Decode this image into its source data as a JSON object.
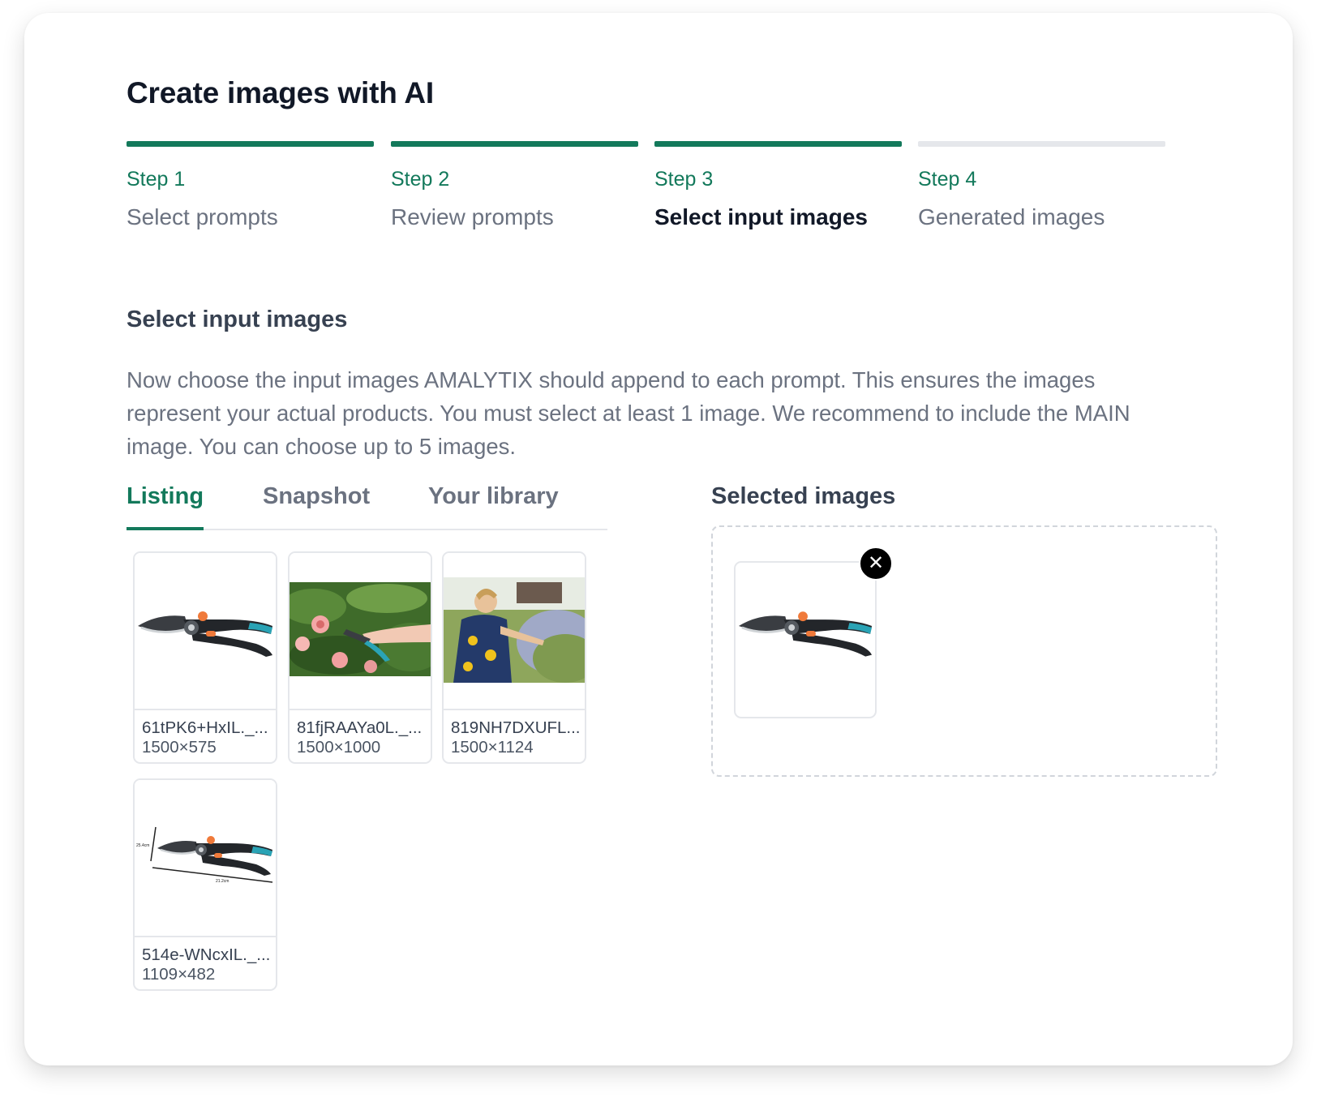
{
  "page": {
    "title": "Create images with AI"
  },
  "steps": [
    {
      "num": "Step 1",
      "label": "Select prompts"
    },
    {
      "num": "Step 2",
      "label": "Review prompts"
    },
    {
      "num": "Step 3",
      "label": "Select input images"
    },
    {
      "num": "Step 4",
      "label": "Generated images"
    }
  ],
  "section": {
    "title": "Select input images",
    "description": "Now choose the input images AMALYTIX should append to each prompt. This ensures the images represent your actual products. You must select at least 1 image. We recommend to include the MAIN image. You can choose up to 5 images."
  },
  "tabs": [
    {
      "label": "Listing"
    },
    {
      "label": "Snapshot"
    },
    {
      "label": "Your library"
    }
  ],
  "images": [
    {
      "name": "61tPK6+HxIL._...",
      "dims": "1500×575"
    },
    {
      "name": "81fjRAAYa0L._...",
      "dims": "1500×1000"
    },
    {
      "name": "819NH7DXUFL...",
      "dims": "1500×1124"
    },
    {
      "name": "514e-WNcxIL._...",
      "dims": "1109×482"
    }
  ],
  "selected": {
    "title": "Selected images",
    "remove_label": "✕"
  },
  "colors": {
    "accent": "#13795b",
    "inactive_bar": "#e5e7eb"
  }
}
